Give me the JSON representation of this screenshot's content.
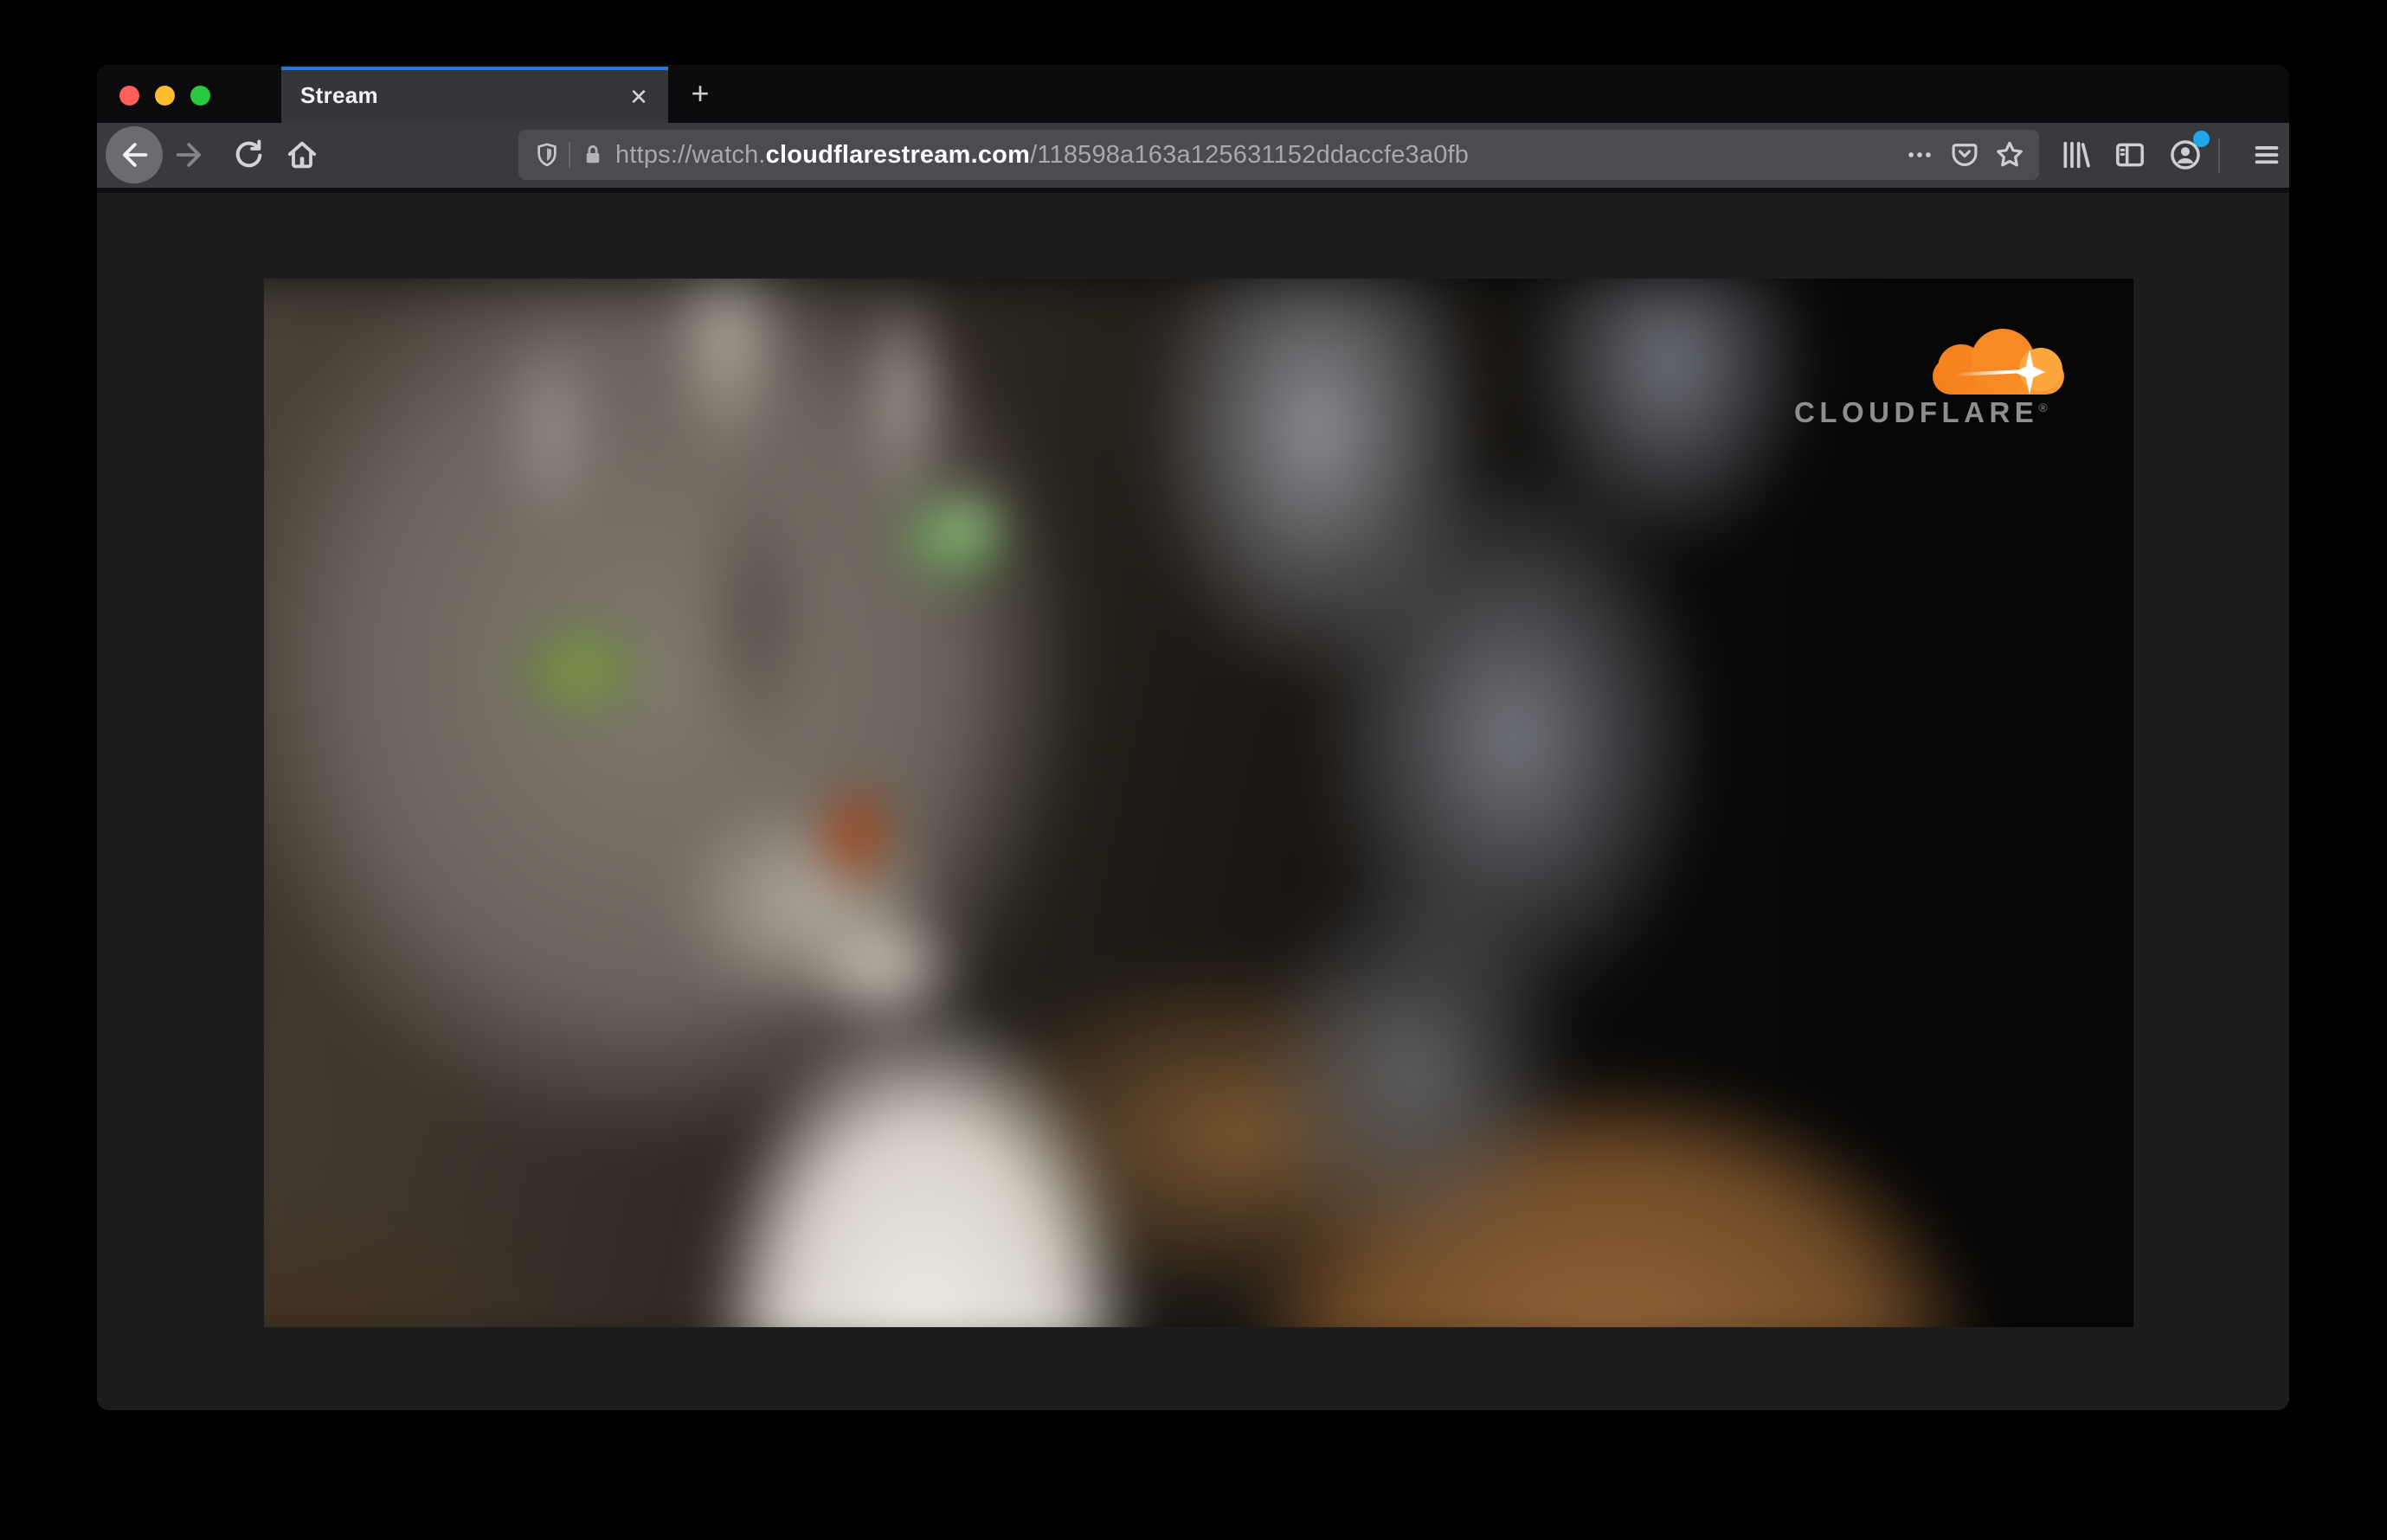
{
  "window": {
    "kind": "firefox-browser-macos-dark",
    "traffic_lights": [
      "close",
      "minimize",
      "zoom"
    ]
  },
  "tab_bar": {
    "active_tab": {
      "label": "Stream",
      "close_icon": "✕",
      "active": true
    },
    "new_tab_icon": "+"
  },
  "toolbar": {
    "url_bar": {
      "scheme": "https://watch.",
      "domain": "cloudflarestream.com",
      "path": "/118598a163a125631152ddaccfe3a0fb",
      "full_url": "https://watch.cloudflarestream.com/118598a163a125631152ddaccfe3a0fb"
    },
    "account_has_notification": true
  },
  "video": {
    "watermark_brand": "CLOUDFLARE",
    "watermark_mark": "®",
    "description": "blurry close-up of a gray tabby cat with green eyes"
  },
  "icons": {
    "back": "left-arrow",
    "forward": "right-arrow",
    "refresh": "circular-arrow",
    "home": "house",
    "tracking_protection": "shield",
    "connection_secure": "padlock",
    "page_actions": "three-dots",
    "pocket": "pocket-badge",
    "bookmark": "star-outline",
    "library": "book-spines",
    "sidebar": "split-panel",
    "account": "person-circle",
    "menu": "hamburger",
    "close_tab": "✕",
    "new_tab": "+"
  },
  "colors": {
    "accent_tab_blue": "#1f7ad9",
    "notification_dot": "#1fa8e8",
    "traffic_red": "#ff5f58",
    "traffic_yellow": "#febc2e",
    "traffic_green": "#28c840",
    "cloudflare_orange": "#f6821f",
    "toolbar_bg": "#39393e",
    "urlbar_bg": "#4b4b50",
    "tabbar_bg": "#0b0b0d",
    "content_bg": "#1d1d20"
  }
}
